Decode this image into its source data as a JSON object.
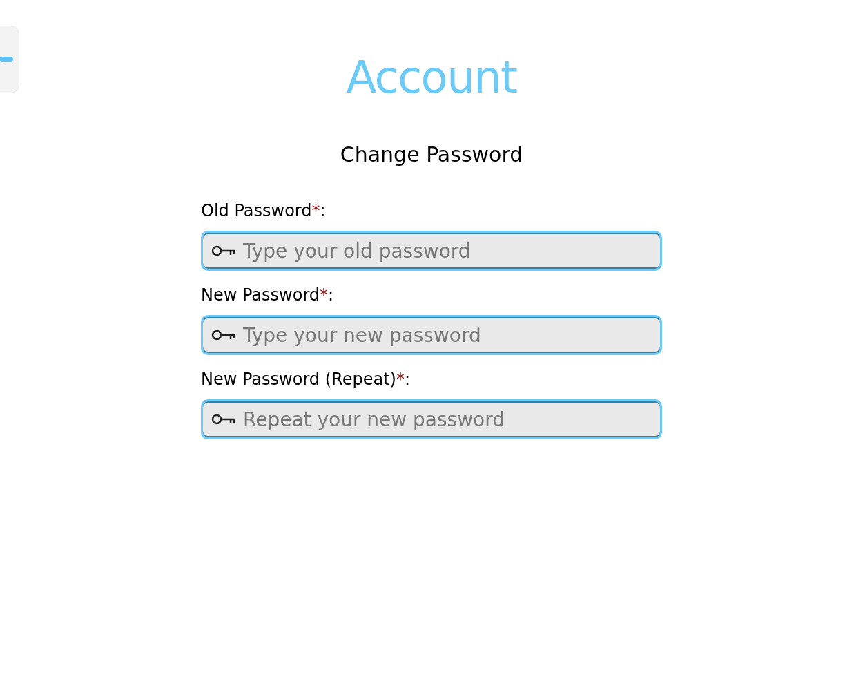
{
  "title": "Account",
  "section_title": "Change Password",
  "fields": [
    {
      "label": "Old Password",
      "required_mark": "*",
      "suffix": ":",
      "placeholder": "Type your old password"
    },
    {
      "label": "New Password",
      "required_mark": "*",
      "suffix": ":",
      "placeholder": "Type your new password"
    },
    {
      "label": "New Password (Repeat)",
      "required_mark": "*",
      "suffix": ":",
      "placeholder": "Repeat your new password"
    }
  ]
}
